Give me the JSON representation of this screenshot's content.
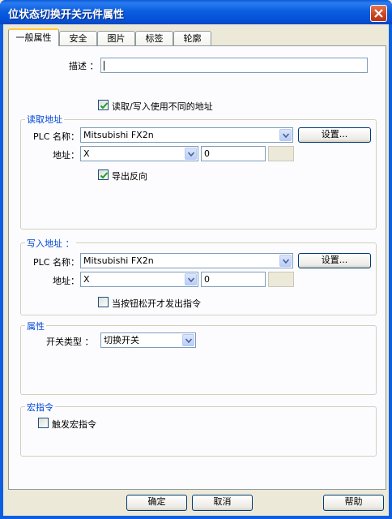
{
  "window": {
    "title": "位状态切换开关元件属性"
  },
  "tabs": [
    {
      "label": "一般属性",
      "active": true
    },
    {
      "label": "安全"
    },
    {
      "label": "图片"
    },
    {
      "label": "标签"
    },
    {
      "label": "轮廓"
    }
  ],
  "general": {
    "description_label": "描述 ：",
    "description_value": "",
    "separate_rw_label": "读取/写入使用不同的地址",
    "separate_rw_checked": true
  },
  "read_address": {
    "title": "读取地址",
    "plc_label": "PLC 名称：",
    "plc_value": "Mitsubishi FX2n",
    "settings_label": "设置...",
    "address_label": "地址：",
    "device_value": "X",
    "address_value": "0",
    "invert_label": "导出反向",
    "invert_checked": true
  },
  "write_address": {
    "title": "写入地址 ：",
    "plc_label": "PLC 名称：",
    "plc_value": "Mitsubishi FX2n",
    "settings_label": "设置...",
    "address_label": "地址：",
    "device_value": "X",
    "address_value": "0",
    "release_label": "当按钮松开才发出指令",
    "release_checked": false
  },
  "attributes": {
    "title": "属性",
    "switch_type_label": "开关类型 ：",
    "switch_type_value": "切换开关"
  },
  "macro": {
    "title": "宏指令",
    "trigger_label": "触发宏指令",
    "trigger_checked": false
  },
  "footer": {
    "ok_label": "确定",
    "cancel_label": "取消",
    "help_label": "帮助"
  },
  "colors": {
    "title_bar": "#0a5ad8",
    "group_title": "#0046d5",
    "panel": "#fcfcfe",
    "dialog": "#ece9d8"
  }
}
